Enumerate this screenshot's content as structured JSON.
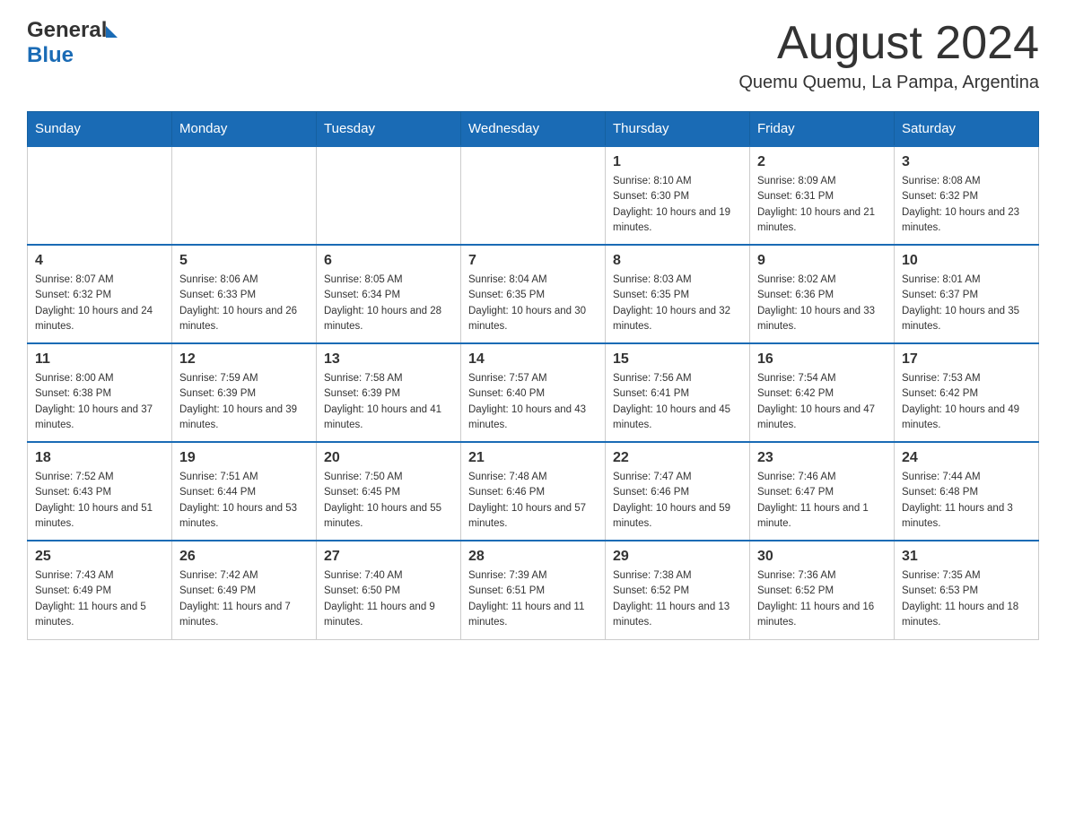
{
  "header": {
    "logo": {
      "general": "General",
      "blue": "Blue"
    },
    "title": "August 2024",
    "location": "Quemu Quemu, La Pampa, Argentina"
  },
  "days_of_week": [
    "Sunday",
    "Monday",
    "Tuesday",
    "Wednesday",
    "Thursday",
    "Friday",
    "Saturday"
  ],
  "weeks": [
    [
      {
        "day": "",
        "sunrise": "",
        "sunset": "",
        "daylight": ""
      },
      {
        "day": "",
        "sunrise": "",
        "sunset": "",
        "daylight": ""
      },
      {
        "day": "",
        "sunrise": "",
        "sunset": "",
        "daylight": ""
      },
      {
        "day": "",
        "sunrise": "",
        "sunset": "",
        "daylight": ""
      },
      {
        "day": "1",
        "sunrise": "Sunrise: 8:10 AM",
        "sunset": "Sunset: 6:30 PM",
        "daylight": "Daylight: 10 hours and 19 minutes."
      },
      {
        "day": "2",
        "sunrise": "Sunrise: 8:09 AM",
        "sunset": "Sunset: 6:31 PM",
        "daylight": "Daylight: 10 hours and 21 minutes."
      },
      {
        "day": "3",
        "sunrise": "Sunrise: 8:08 AM",
        "sunset": "Sunset: 6:32 PM",
        "daylight": "Daylight: 10 hours and 23 minutes."
      }
    ],
    [
      {
        "day": "4",
        "sunrise": "Sunrise: 8:07 AM",
        "sunset": "Sunset: 6:32 PM",
        "daylight": "Daylight: 10 hours and 24 minutes."
      },
      {
        "day": "5",
        "sunrise": "Sunrise: 8:06 AM",
        "sunset": "Sunset: 6:33 PM",
        "daylight": "Daylight: 10 hours and 26 minutes."
      },
      {
        "day": "6",
        "sunrise": "Sunrise: 8:05 AM",
        "sunset": "Sunset: 6:34 PM",
        "daylight": "Daylight: 10 hours and 28 minutes."
      },
      {
        "day": "7",
        "sunrise": "Sunrise: 8:04 AM",
        "sunset": "Sunset: 6:35 PM",
        "daylight": "Daylight: 10 hours and 30 minutes."
      },
      {
        "day": "8",
        "sunrise": "Sunrise: 8:03 AM",
        "sunset": "Sunset: 6:35 PM",
        "daylight": "Daylight: 10 hours and 32 minutes."
      },
      {
        "day": "9",
        "sunrise": "Sunrise: 8:02 AM",
        "sunset": "Sunset: 6:36 PM",
        "daylight": "Daylight: 10 hours and 33 minutes."
      },
      {
        "day": "10",
        "sunrise": "Sunrise: 8:01 AM",
        "sunset": "Sunset: 6:37 PM",
        "daylight": "Daylight: 10 hours and 35 minutes."
      }
    ],
    [
      {
        "day": "11",
        "sunrise": "Sunrise: 8:00 AM",
        "sunset": "Sunset: 6:38 PM",
        "daylight": "Daylight: 10 hours and 37 minutes."
      },
      {
        "day": "12",
        "sunrise": "Sunrise: 7:59 AM",
        "sunset": "Sunset: 6:39 PM",
        "daylight": "Daylight: 10 hours and 39 minutes."
      },
      {
        "day": "13",
        "sunrise": "Sunrise: 7:58 AM",
        "sunset": "Sunset: 6:39 PM",
        "daylight": "Daylight: 10 hours and 41 minutes."
      },
      {
        "day": "14",
        "sunrise": "Sunrise: 7:57 AM",
        "sunset": "Sunset: 6:40 PM",
        "daylight": "Daylight: 10 hours and 43 minutes."
      },
      {
        "day": "15",
        "sunrise": "Sunrise: 7:56 AM",
        "sunset": "Sunset: 6:41 PM",
        "daylight": "Daylight: 10 hours and 45 minutes."
      },
      {
        "day": "16",
        "sunrise": "Sunrise: 7:54 AM",
        "sunset": "Sunset: 6:42 PM",
        "daylight": "Daylight: 10 hours and 47 minutes."
      },
      {
        "day": "17",
        "sunrise": "Sunrise: 7:53 AM",
        "sunset": "Sunset: 6:42 PM",
        "daylight": "Daylight: 10 hours and 49 minutes."
      }
    ],
    [
      {
        "day": "18",
        "sunrise": "Sunrise: 7:52 AM",
        "sunset": "Sunset: 6:43 PM",
        "daylight": "Daylight: 10 hours and 51 minutes."
      },
      {
        "day": "19",
        "sunrise": "Sunrise: 7:51 AM",
        "sunset": "Sunset: 6:44 PM",
        "daylight": "Daylight: 10 hours and 53 minutes."
      },
      {
        "day": "20",
        "sunrise": "Sunrise: 7:50 AM",
        "sunset": "Sunset: 6:45 PM",
        "daylight": "Daylight: 10 hours and 55 minutes."
      },
      {
        "day": "21",
        "sunrise": "Sunrise: 7:48 AM",
        "sunset": "Sunset: 6:46 PM",
        "daylight": "Daylight: 10 hours and 57 minutes."
      },
      {
        "day": "22",
        "sunrise": "Sunrise: 7:47 AM",
        "sunset": "Sunset: 6:46 PM",
        "daylight": "Daylight: 10 hours and 59 minutes."
      },
      {
        "day": "23",
        "sunrise": "Sunrise: 7:46 AM",
        "sunset": "Sunset: 6:47 PM",
        "daylight": "Daylight: 11 hours and 1 minute."
      },
      {
        "day": "24",
        "sunrise": "Sunrise: 7:44 AM",
        "sunset": "Sunset: 6:48 PM",
        "daylight": "Daylight: 11 hours and 3 minutes."
      }
    ],
    [
      {
        "day": "25",
        "sunrise": "Sunrise: 7:43 AM",
        "sunset": "Sunset: 6:49 PM",
        "daylight": "Daylight: 11 hours and 5 minutes."
      },
      {
        "day": "26",
        "sunrise": "Sunrise: 7:42 AM",
        "sunset": "Sunset: 6:49 PM",
        "daylight": "Daylight: 11 hours and 7 minutes."
      },
      {
        "day": "27",
        "sunrise": "Sunrise: 7:40 AM",
        "sunset": "Sunset: 6:50 PM",
        "daylight": "Daylight: 11 hours and 9 minutes."
      },
      {
        "day": "28",
        "sunrise": "Sunrise: 7:39 AM",
        "sunset": "Sunset: 6:51 PM",
        "daylight": "Daylight: 11 hours and 11 minutes."
      },
      {
        "day": "29",
        "sunrise": "Sunrise: 7:38 AM",
        "sunset": "Sunset: 6:52 PM",
        "daylight": "Daylight: 11 hours and 13 minutes."
      },
      {
        "day": "30",
        "sunrise": "Sunrise: 7:36 AM",
        "sunset": "Sunset: 6:52 PM",
        "daylight": "Daylight: 11 hours and 16 minutes."
      },
      {
        "day": "31",
        "sunrise": "Sunrise: 7:35 AM",
        "sunset": "Sunset: 6:53 PM",
        "daylight": "Daylight: 11 hours and 18 minutes."
      }
    ]
  ]
}
